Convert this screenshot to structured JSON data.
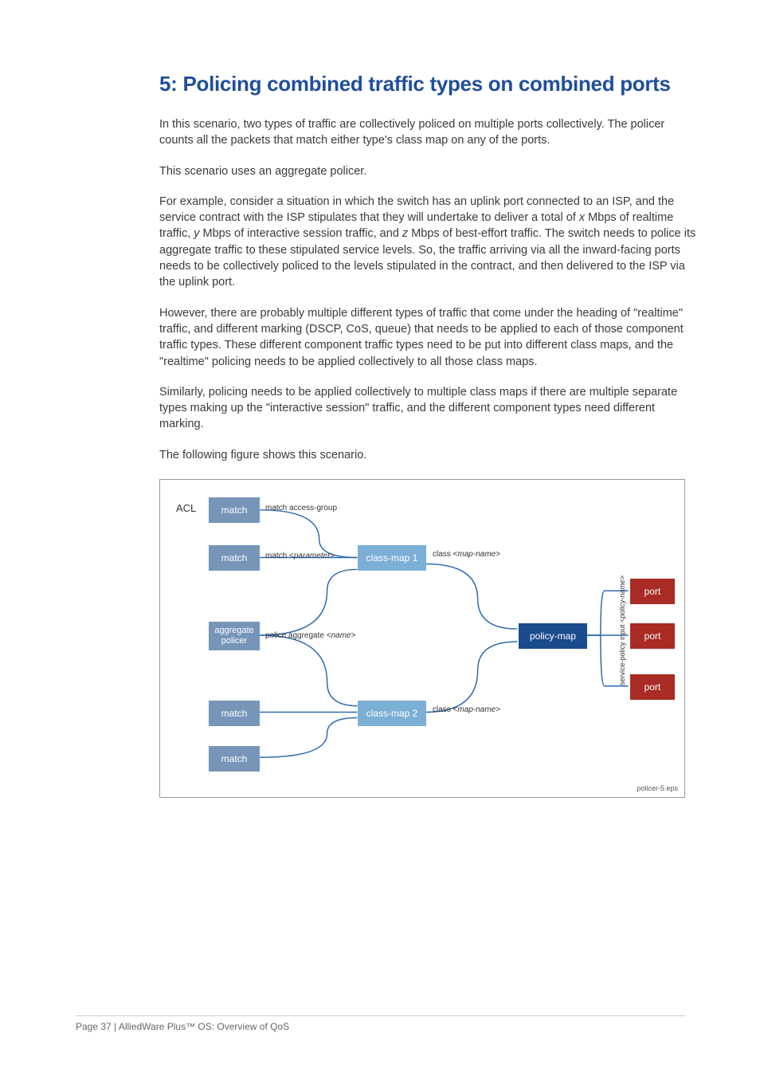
{
  "title": "5: Policing combined traffic types on combined ports",
  "p1": "In this scenario, two types of traffic are collectively policed on multiple ports collectively. The policer counts all the packets that match either type's class map on any of the ports.",
  "p2": "This scenario uses an aggregate policer.",
  "p3a": "For example, consider a situation in which the switch has an uplink port connected to an ISP, and the service contract with the ISP stipulates that they will undertake to deliver a total of ",
  "p3x": "x",
  "p3b": " Mbps of realtime traffic, ",
  "p3y": "y",
  "p3c": " Mbps of interactive session traffic, and ",
  "p3z": "z",
  "p3d": " Mbps of best-effort traffic. The switch needs to police its aggregate traffic to these stipulated service levels. So, the traffic arriving via all the inward-facing ports needs to be collectively policed to the levels stipulated in the contract, and then delivered to the ISP via the uplink port.",
  "p4": "However, there are probably multiple different types of traffic that come under the heading of \"realtime\" traffic, and different marking (DSCP, CoS, queue) that needs to be applied to each of those component traffic types. These different component traffic types need to be put into different class maps, and the \"realtime\" policing needs to be applied collectively to all those class maps.",
  "p5": "Similarly, policing needs to be applied collectively to multiple class maps if there are multiple separate types making up the \"interactive session\" traffic, and the different component types need different marking.",
  "p6": "The following figure shows this scenario.",
  "diagram": {
    "acl": "ACL",
    "match": "match",
    "aggregateLine1": "aggregate",
    "aggregateLine2": "policer",
    "classmap1": "class-map 1",
    "classmap2": "class-map 2",
    "policymap": "policy-map",
    "port": "port",
    "matchAccessGroup": "match access-group",
    "matchParamPrefix": "match <",
    "matchParamItalic": "parameter",
    "matchParamSuffix": ">",
    "policeAggPrefix": "police aggregate <",
    "policeAggItalic": "name",
    "policeAggSuffix": ">",
    "classPrefix": "class <",
    "classItalic": "map-name",
    "classSuffix": ">",
    "servicePrefix": "service-policy input <",
    "serviceItalic": "policy-name",
    "serviceSuffix": ">",
    "eps": "policer-5.eps"
  },
  "footer": "Page 37 | AlliedWare Plus™ OS: Overview of QoS"
}
